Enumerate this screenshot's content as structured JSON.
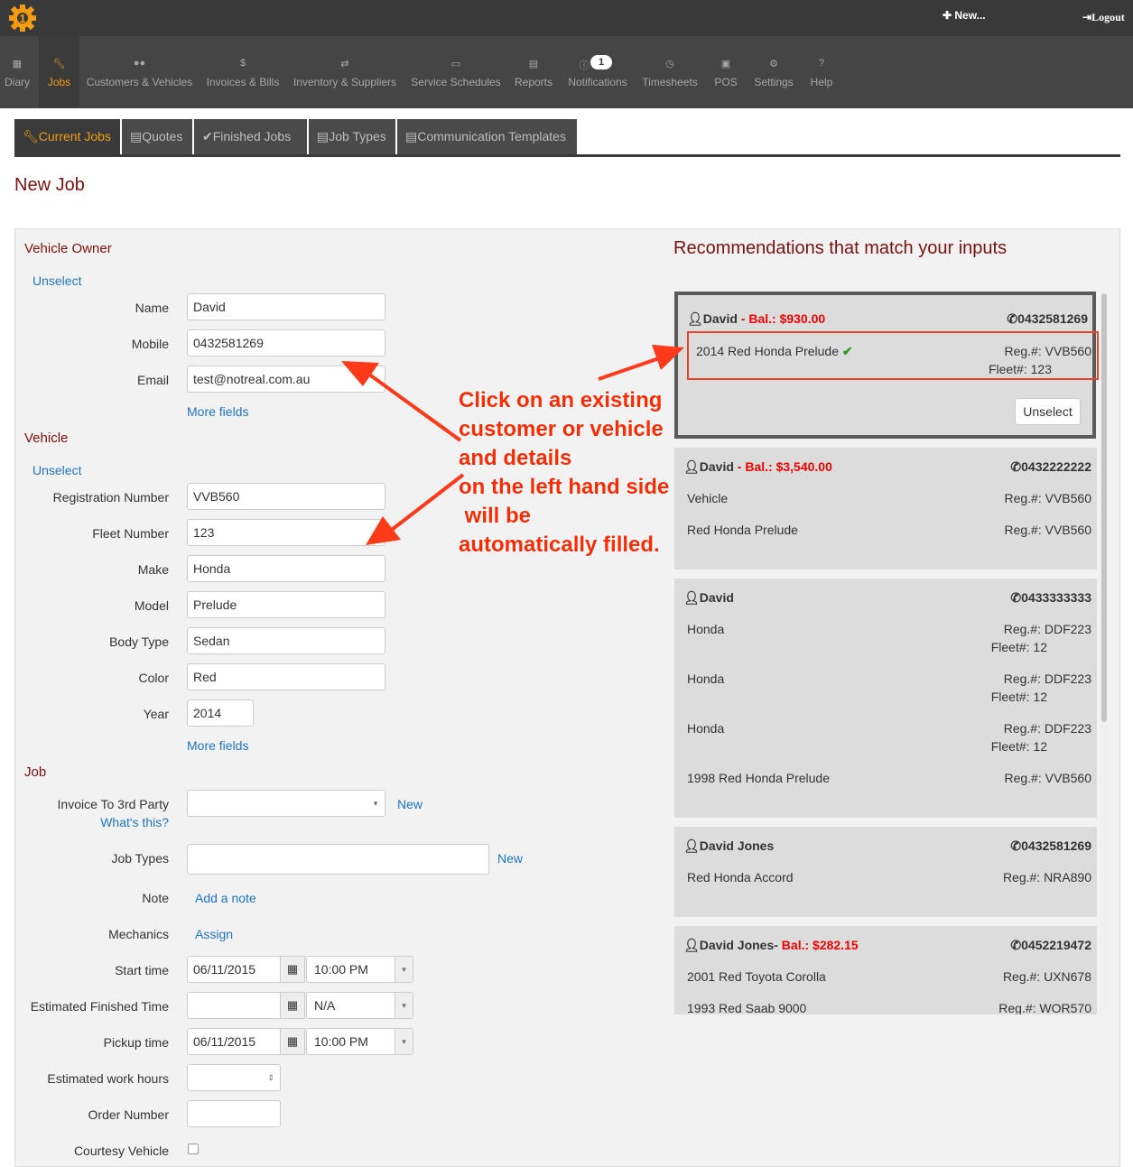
{
  "header": {
    "new_label": "✚ New...",
    "logout_label": "Logout"
  },
  "nav": [
    {
      "label": "Diary",
      "icon": "calendar-icon"
    },
    {
      "label": "Jobs",
      "icon": "wrench-icon"
    },
    {
      "label": "Customers & Vehicles",
      "icon": "users-icon"
    },
    {
      "label": "Invoices & Bills",
      "icon": "dollar-icon"
    },
    {
      "label": "Inventory & Suppliers",
      "icon": "transfer-icon"
    },
    {
      "label": "Service Schedules",
      "icon": "calendar-icon"
    },
    {
      "label": "Reports",
      "icon": "chart-icon"
    },
    {
      "label": "Notifications",
      "icon": "info-icon",
      "badge": "1"
    },
    {
      "label": "Timesheets",
      "icon": "clock-icon"
    },
    {
      "label": "POS",
      "icon": "money-icon"
    },
    {
      "label": "Settings",
      "icon": "gears-icon"
    },
    {
      "label": "Help",
      "icon": "question-icon"
    }
  ],
  "tabs": [
    {
      "label": "Current Jobs",
      "icon": "wrench-icon"
    },
    {
      "label": "Quotes",
      "icon": "file-icon"
    },
    {
      "label": "Finished Jobs",
      "icon": "check-icon"
    },
    {
      "label": "Job Types",
      "icon": "file-icon"
    },
    {
      "label": "Communication Templates",
      "icon": "file-icon"
    }
  ],
  "page_title": "New Job",
  "owner": {
    "title": "Vehicle Owner",
    "unselect": "Unselect",
    "name_label": "Name",
    "name": "David",
    "mobile_label": "Mobile",
    "mobile": "0432581269",
    "email_label": "Email",
    "email": "test@notreal.com.au",
    "more_fields": "More fields"
  },
  "vehicle": {
    "title": "Vehicle",
    "unselect": "Unselect",
    "reg_label": "Registration Number",
    "reg": "VVB560",
    "fleet_label": "Fleet Number",
    "fleet": "123",
    "make_label": "Make",
    "make": "Honda",
    "model_label": "Model",
    "model": "Prelude",
    "body_label": "Body Type",
    "body": "Sedan",
    "color_label": "Color",
    "color": "Red",
    "year_label": "Year",
    "year": "2014",
    "more_fields": "More fields"
  },
  "job": {
    "title": "Job",
    "invoice_label": "Invoice To 3rd Party",
    "whats_this": "What's this?",
    "new_label": "New",
    "job_types_label": "Job Types",
    "note_label": "Note",
    "add_note": "Add a note",
    "mechanics_label": "Mechanics",
    "assign": "Assign",
    "start_label": "Start time",
    "start_date": "06/11/2015",
    "start_time": "10:00 PM",
    "finish_label": "Estimated Finished Time",
    "finish_date": "",
    "finish_time": "N/A",
    "pickup_label": "Pickup time",
    "pickup_date": "06/11/2015",
    "pickup_time": "10:00 PM",
    "work_hours_label": "Estimated work hours",
    "order_label": "Order Number",
    "courtesy_label": "Courtesy Vehicle"
  },
  "recommendations": {
    "title": "Recommendations that match your inputs",
    "unselect": "Unselect",
    "cards": [
      {
        "name": "David",
        "balance": " - Bal.: $930.00",
        "phone": "0432581269",
        "vehicles": [
          {
            "desc": "2014 Red Honda Prelude",
            "reg": "Reg.#: VVB560",
            "fleet": "Fleet#: 123"
          }
        ]
      },
      {
        "name": "David",
        "balance": " - Bal.: $3,540.00",
        "phone": "0432222222",
        "vehicles": [
          {
            "desc": "Vehicle",
            "reg": "Reg.#: VVB560"
          },
          {
            "desc": "Red Honda Prelude",
            "reg": "Reg.#: VVB560"
          }
        ]
      },
      {
        "name": "David",
        "balance": "",
        "phone": "0433333333",
        "vehicles": [
          {
            "desc": "Honda",
            "reg": "Reg.#: DDF223",
            "fleet": "Fleet#: 12"
          },
          {
            "desc": "Honda",
            "reg": "Reg.#: DDF223",
            "fleet": "Fleet#: 12"
          },
          {
            "desc": "Honda",
            "reg": "Reg.#: DDF223",
            "fleet": "Fleet#: 12"
          },
          {
            "desc": "1998 Red Honda Prelude",
            "reg": "Reg.#: VVB560"
          }
        ]
      },
      {
        "name": "David Jones",
        "balance": "",
        "phone": "0432581269",
        "vehicles": [
          {
            "desc": "Red Honda Accord",
            "reg": "Reg.#: NRA890"
          }
        ]
      },
      {
        "name": "David Jones-",
        "balance": " Bal.: $282.15",
        "phone": "0452219472",
        "vehicles": [
          {
            "desc": "2001 Red Toyota Corolla",
            "reg": "Reg.#: UXN678"
          },
          {
            "desc": "1993 Red Saab 9000",
            "reg": "Reg.#: WOR570"
          }
        ]
      }
    ]
  },
  "annotation": {
    "lines": [
      "Click on an existing",
      "customer or vehicle",
      "and details",
      "on the left hand side",
      " will be",
      "automatically filled."
    ]
  },
  "colors": {
    "accent": "#f39c12",
    "title": "#7a1010",
    "link": "#1f75c1",
    "balance": "#ee0000",
    "annotation": "#ff2a00"
  }
}
